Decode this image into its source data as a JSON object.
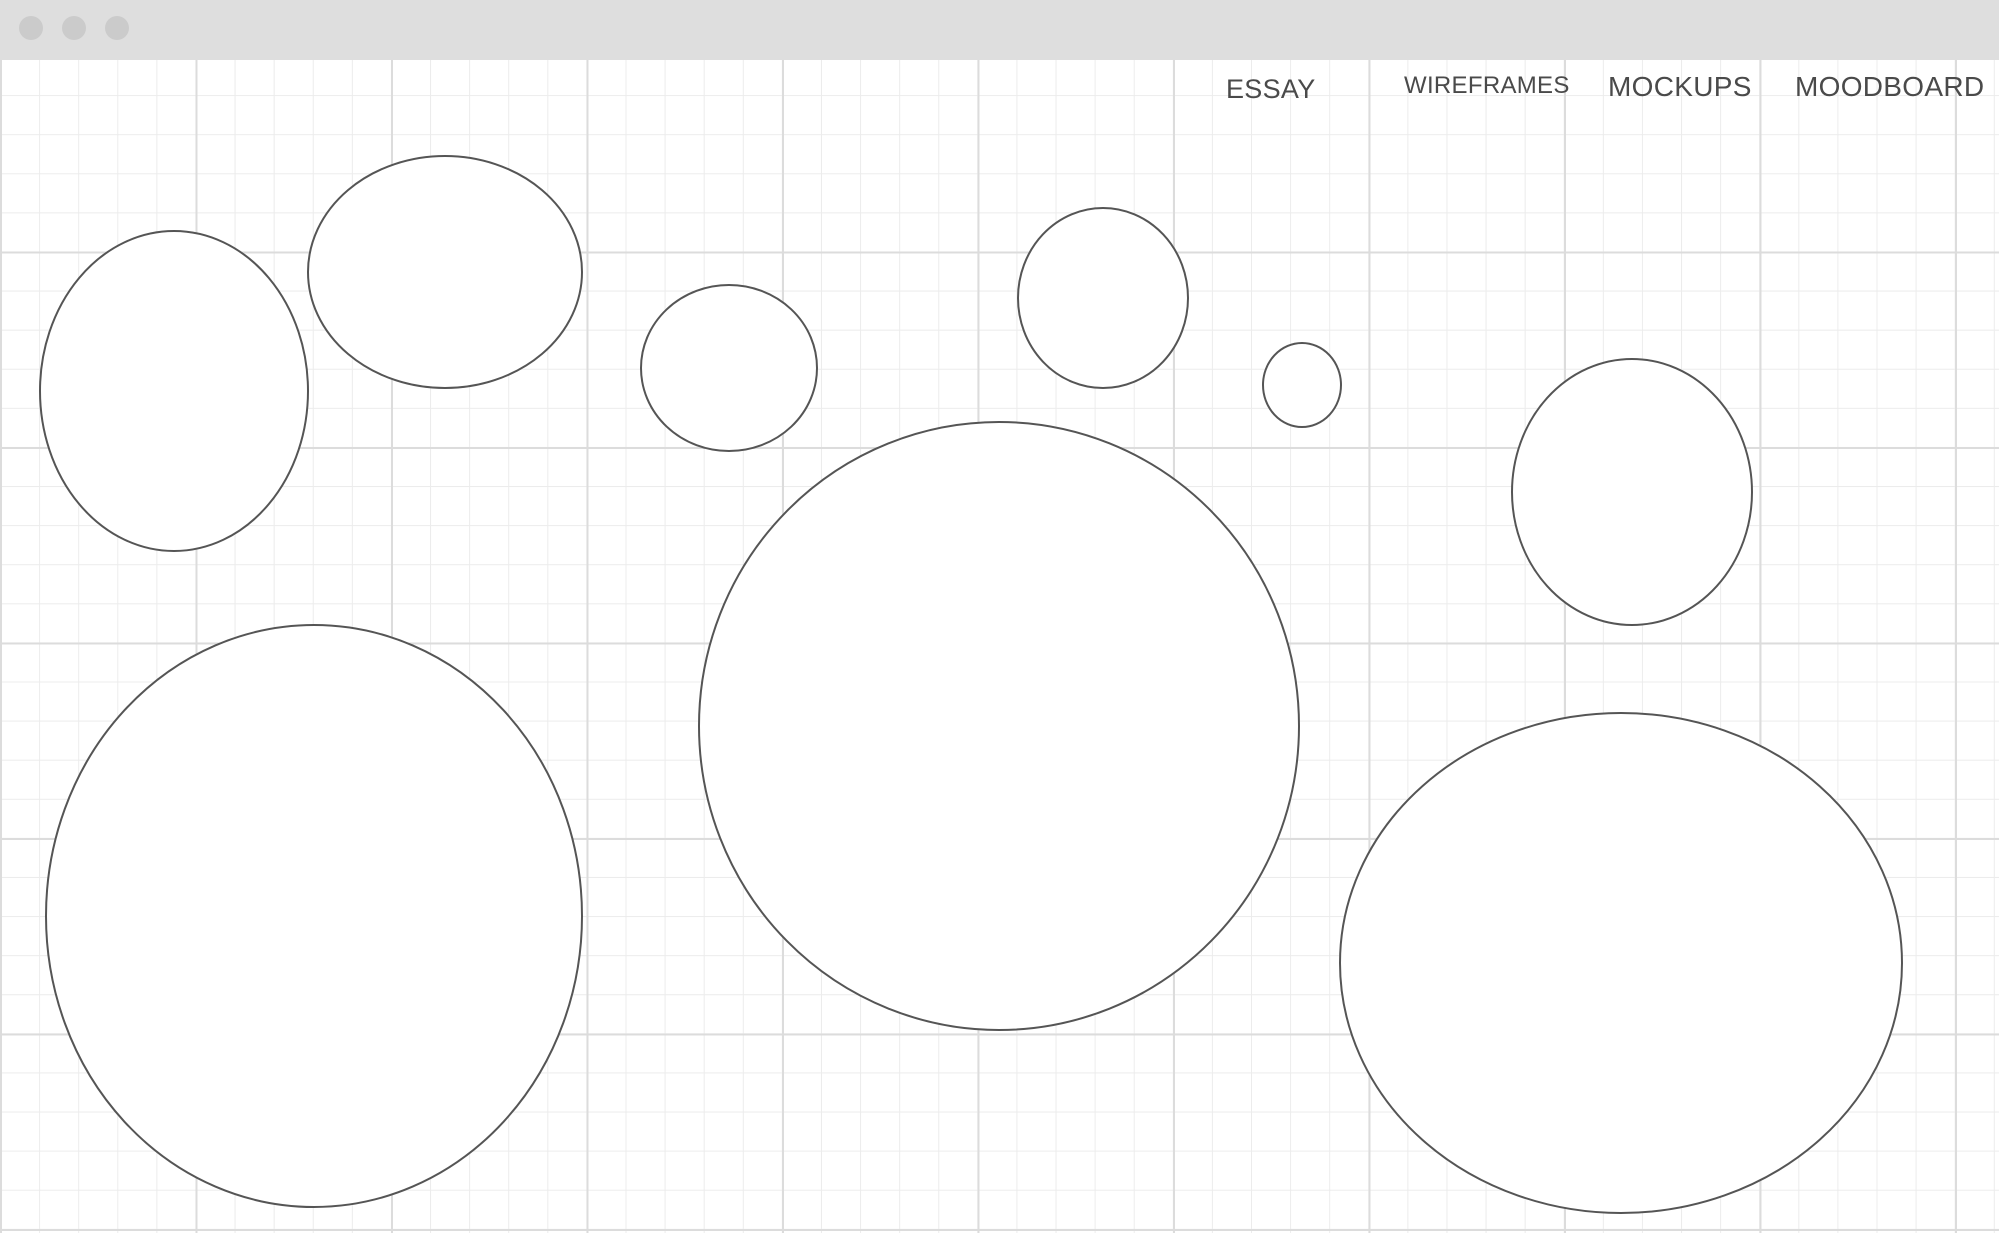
{
  "window": {
    "controls": [
      "close",
      "minimize",
      "zoom"
    ]
  },
  "nav": {
    "essay_label": "ESSAY",
    "wireframes_label": "WIREFRAMES",
    "mockups_label": "MOCKUPS",
    "moodboard_label": "MOODBOARD"
  },
  "colors": {
    "titlebar": "#dedede",
    "grid_major": "#dcdcdc",
    "grid_minor": "#ececec",
    "shape_stroke": "#555555",
    "nav_text": "#4a4a4a"
  }
}
